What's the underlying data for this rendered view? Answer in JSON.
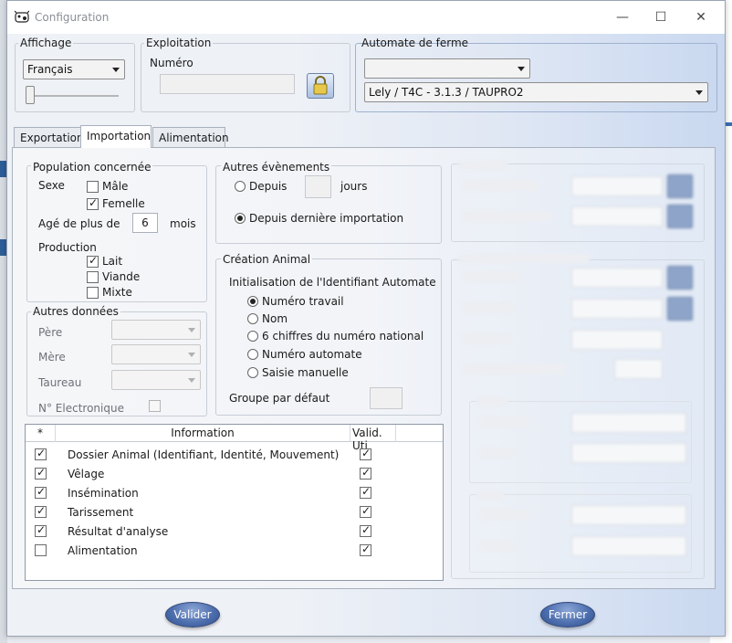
{
  "window": {
    "title": "Configuration",
    "minimize": "—",
    "maximize": "☐",
    "close": "✕"
  },
  "affichage": {
    "label": "Affichage",
    "language": "Français"
  },
  "exploitation": {
    "label": "Exploitation",
    "numero_label": "Numéro",
    "numero_value": ""
  },
  "automate": {
    "label": "Automate de ferme",
    "combo1": "",
    "combo2": "Lely / T4C - 3.1.3 / TAUPRO2"
  },
  "tabs": [
    {
      "label": "Exportation"
    },
    {
      "label": "Importation"
    },
    {
      "label": "Alimentation"
    }
  ],
  "population": {
    "label": "Population concernée",
    "sexe_label": "Sexe",
    "male": {
      "label": "Mâle",
      "checked": false
    },
    "femelle": {
      "label": "Femelle",
      "checked": true
    },
    "age_label": "Agé de plus de",
    "age_value": "6",
    "age_unit": "mois",
    "production_label": "Production",
    "lait": {
      "label": "Lait",
      "checked": true
    },
    "viande": {
      "label": "Viande",
      "checked": false
    },
    "mixte": {
      "label": "Mixte",
      "checked": false
    }
  },
  "autres_donnees": {
    "label": "Autres données",
    "pere": "Père",
    "mere": "Mère",
    "taureau": "Taureau",
    "n_electronique": "N° Electronique"
  },
  "autres_evenements": {
    "label": "Autres évènements",
    "depuis": "Depuis",
    "jours": "jours",
    "depuis_derniere": "Depuis dernière importation",
    "selected": "depuis_derniere"
  },
  "creation_animal": {
    "label": "Création Animal",
    "init_label": "Initialisation de l'Identifiant Automate",
    "options": [
      "Numéro travail",
      "Nom",
      "6 chiffres du numéro national",
      "Numéro automate",
      "Saisie manuelle"
    ],
    "selected_index": 0,
    "groupe_label": "Groupe par défaut"
  },
  "table": {
    "headers": [
      "*",
      "Information",
      "Valid. Uti"
    ],
    "rows": [
      {
        "checked": true,
        "info": "Dossier Animal (Identifiant, Identité, Mouvement)",
        "valid": true
      },
      {
        "checked": true,
        "info": "Vêlage",
        "valid": true
      },
      {
        "checked": true,
        "info": "Insémination",
        "valid": true
      },
      {
        "checked": true,
        "info": "Tarissement",
        "valid": true
      },
      {
        "checked": true,
        "info": "Résultat d'analyse",
        "valid": true
      },
      {
        "checked": false,
        "info": "Alimentation",
        "valid": true
      }
    ]
  },
  "buttons": {
    "valider": "Valider",
    "fermer": "Fermer"
  }
}
